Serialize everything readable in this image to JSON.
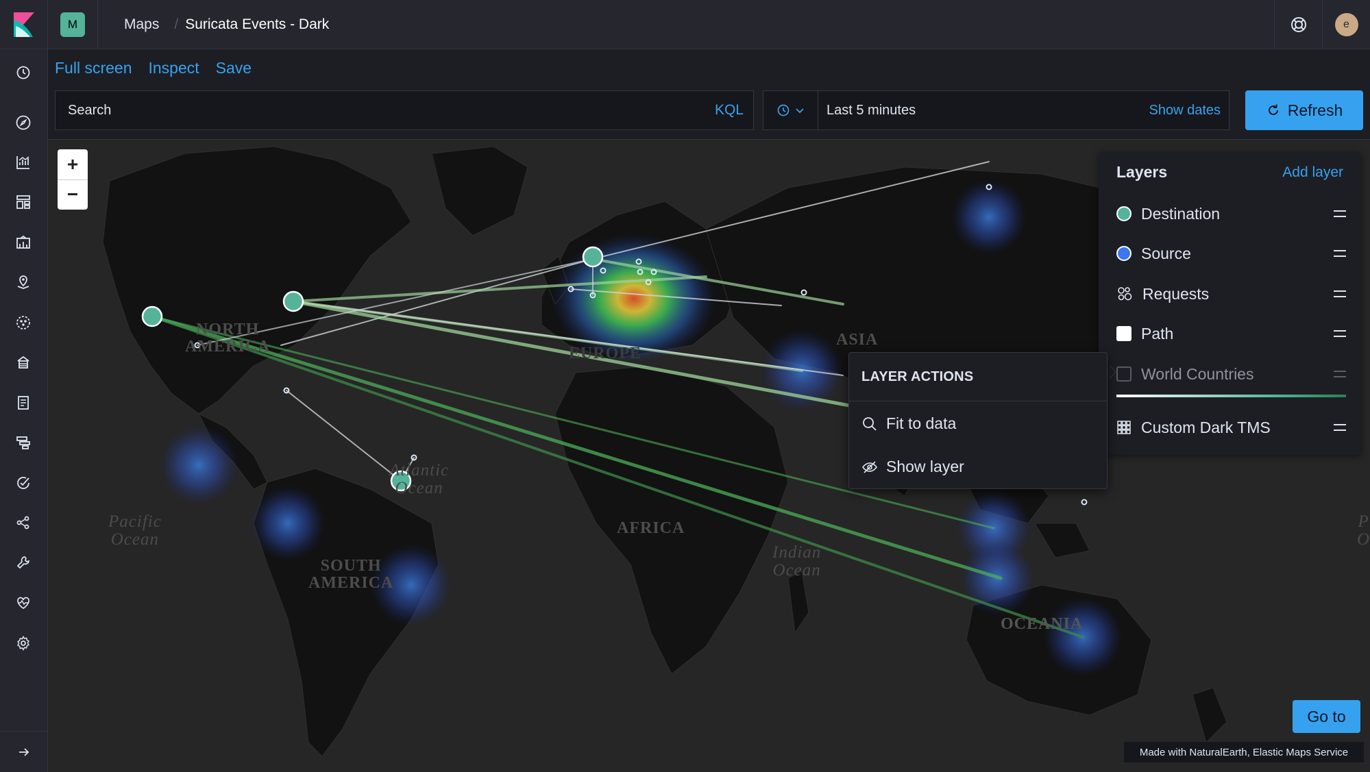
{
  "header": {
    "space_initial": "M",
    "breadcrumb_app": "Maps",
    "breadcrumb_sep": "/",
    "breadcrumb_current": "Suricata Events - Dark",
    "user_initial": "e"
  },
  "toolbar": {
    "full_screen": "Full screen",
    "inspect": "Inspect",
    "save": "Save"
  },
  "query": {
    "search_placeholder": "Search",
    "language": "KQL",
    "time_range": "Last 5 minutes",
    "show_dates": "Show dates",
    "refresh": "Refresh"
  },
  "layers": {
    "title": "Layers",
    "add_layer": "Add layer",
    "items": [
      {
        "name": "Destination",
        "color": "#54b399"
      },
      {
        "name": "Source",
        "color": "#3b77f0"
      },
      {
        "name": "Requests",
        "color": ""
      },
      {
        "name": "Path",
        "color": "#ffffff"
      },
      {
        "name": "World Countries",
        "color": ""
      },
      {
        "name": "Custom Dark TMS",
        "color": ""
      }
    ]
  },
  "layer_actions": {
    "title": "LAYER ACTIONS",
    "fit_to_data": "Fit to data",
    "show_layer": "Show layer"
  },
  "map_labels": {
    "north_america": "NORTH\nAMERICA",
    "south_america": "SOUTH\nAMERICA",
    "europe": "EUROPE",
    "asia": "ASIA",
    "africa": "AFRICA",
    "oceania": "OCEANIA",
    "atlantic": "Atlantic\nOcean",
    "pacific": "Pacific\nOcean",
    "indian": "Indian\nOcean",
    "pacific_right": "P\nO"
  },
  "footer": {
    "go_to": "Go to",
    "attribution": "Made with NaturalEarth, Elastic Maps Service"
  }
}
